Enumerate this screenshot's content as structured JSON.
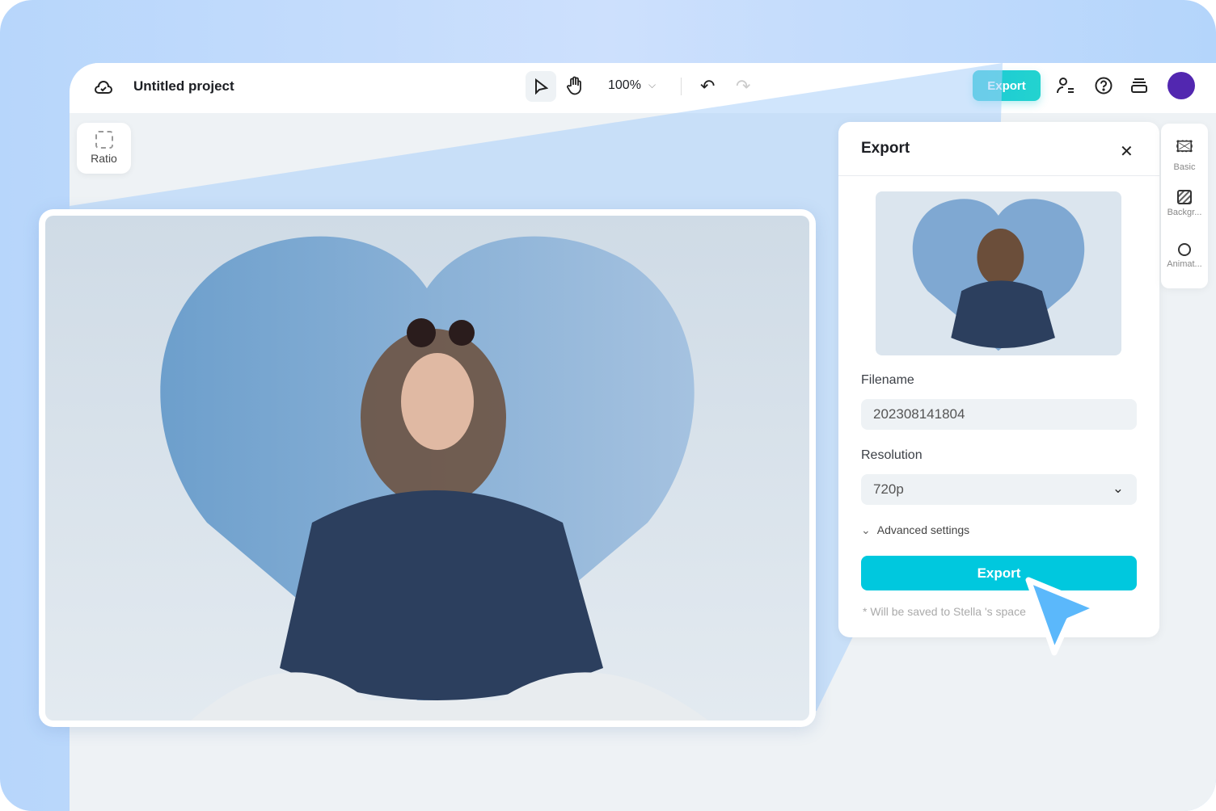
{
  "topbar": {
    "project_title": "Untitled project",
    "zoom": "100%",
    "export_label": "Export"
  },
  "left_tools": {
    "ratio_label": "Ratio"
  },
  "export_panel": {
    "title": "Export",
    "filename_label": "Filename",
    "filename_value": "202308141804",
    "resolution_label": "Resolution",
    "resolution_value": "720p",
    "advanced_label": "Advanced settings",
    "export_button": "Export",
    "save_note": "* Will be saved to Stella 's space"
  },
  "side_tabs": [
    {
      "label": "Basic"
    },
    {
      "label": "Backgr..."
    },
    {
      "label": "Animat..."
    }
  ],
  "colors": {
    "accent": "#00c8de",
    "avatar": "#5227b0",
    "cursor": "#5bb8fb"
  }
}
